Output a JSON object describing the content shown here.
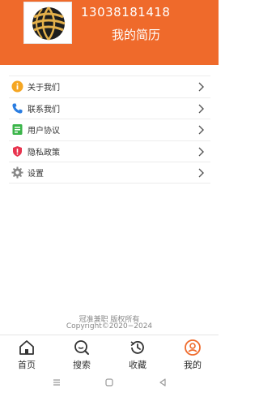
{
  "profile": {
    "phone": "13038181418",
    "resume_link": "我的简历"
  },
  "menu": {
    "items": [
      {
        "label": "关于我们",
        "icon": "info-icon"
      },
      {
        "label": "联系我们",
        "icon": "phone-icon"
      },
      {
        "label": "用户协议",
        "icon": "agreement-icon"
      },
      {
        "label": "隐私政策",
        "icon": "privacy-shield-icon"
      },
      {
        "label": "设置",
        "icon": "gear-icon"
      }
    ]
  },
  "footer": {
    "line1": "冠准兼职  版权所有",
    "line2": "Copyright©2020−2024"
  },
  "tabbar": {
    "tabs": [
      {
        "label": "首页",
        "icon": "home-icon"
      },
      {
        "label": "搜索",
        "icon": "search-icon"
      },
      {
        "label": "收藏",
        "icon": "history-icon"
      },
      {
        "label": "我的",
        "icon": "user-icon",
        "active": true
      }
    ]
  },
  "colors": {
    "brand": "#ef6a2b",
    "active_tab": "#ef6a2b",
    "info_icon": "#f5a623",
    "phone_icon": "#2a7de1",
    "agreement_icon": "#3bb54a",
    "privacy_icon": "#e8344e",
    "gear_icon": "#888888"
  }
}
